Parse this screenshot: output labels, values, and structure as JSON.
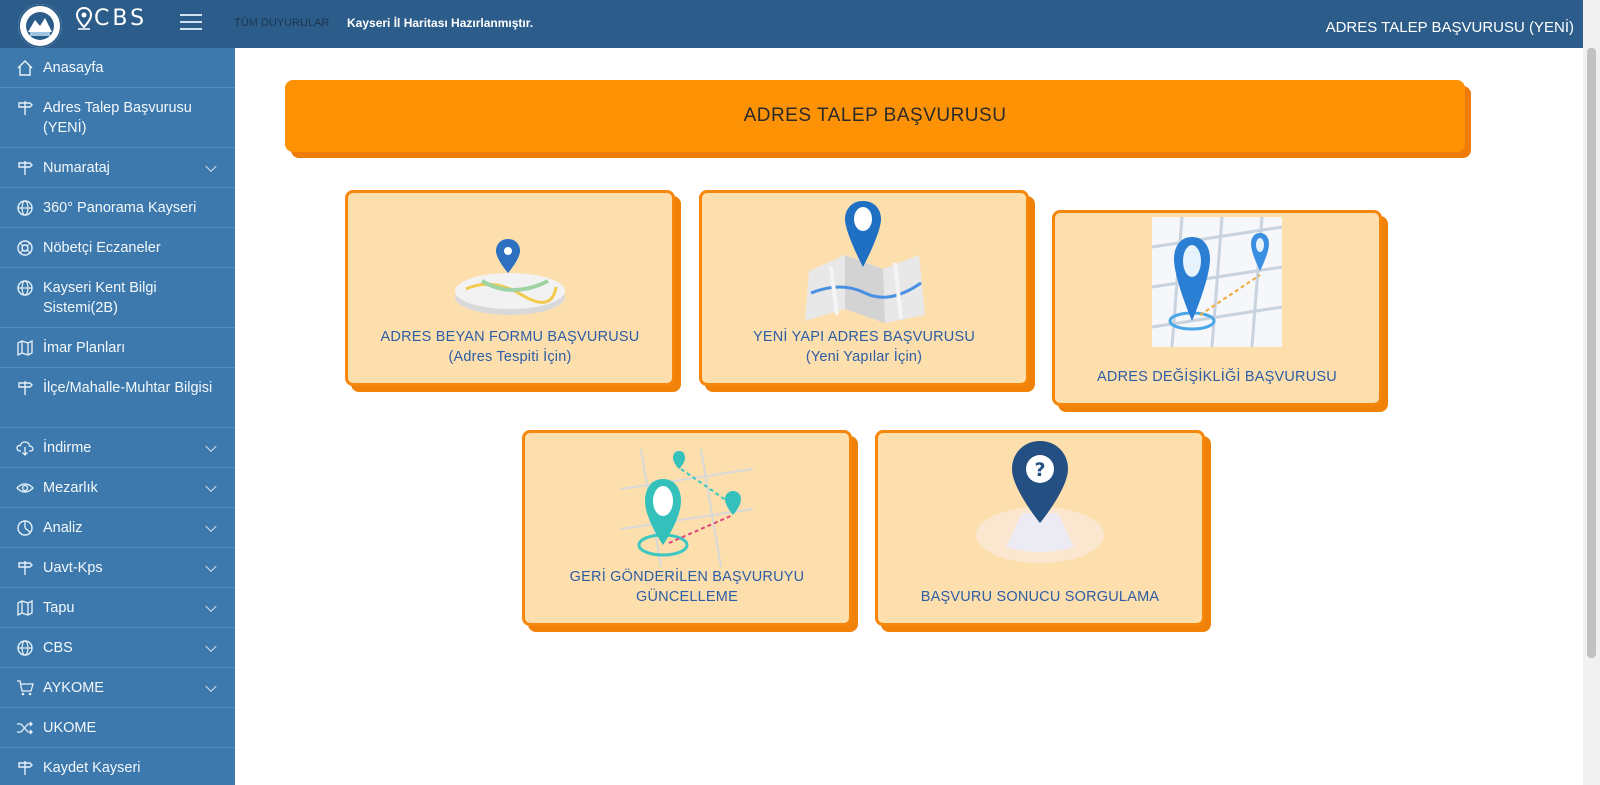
{
  "topbar": {
    "brand": "CBS",
    "all_news": "TÜM DUYURULAR",
    "ticker": "Kayseri İl Haritası Hazırlanmıştır.",
    "page_title": "ADRES TALEP BAŞVURUSU (YENİ)"
  },
  "sidebar": {
    "items": [
      {
        "label": "Anasayfa",
        "icon": "home-icon",
        "has_children": false
      },
      {
        "label": "Adres Talep Başvurusu (YENİ)",
        "icon": "signpost-icon",
        "has_children": false
      },
      {
        "label": "Numarataj",
        "icon": "signpost-icon",
        "has_children": true
      },
      {
        "label": "360° Panorama Kayseri",
        "icon": "globe-icon",
        "has_children": false
      },
      {
        "label": "Nöbetçi Eczaneler",
        "icon": "lifebuoy-icon",
        "has_children": false
      },
      {
        "label": "Kayseri Kent Bilgi Sistemi(2B)",
        "icon": "globe-icon",
        "has_children": false
      },
      {
        "label": "İmar Planları",
        "icon": "map-icon",
        "has_children": false
      },
      {
        "label": "İlçe/Mahalle-Muhtar Bilgisi",
        "icon": "signpost-icon",
        "has_children": false
      },
      {
        "label": "İndirme",
        "icon": "cloud-download-icon",
        "has_children": true
      },
      {
        "label": "Mezarlık",
        "icon": "eye-icon",
        "has_children": true
      },
      {
        "label": "Analiz",
        "icon": "pie-icon",
        "has_children": true
      },
      {
        "label": "Uavt-Kps",
        "icon": "signpost-icon",
        "has_children": true
      },
      {
        "label": "Tapu",
        "icon": "map-icon",
        "has_children": true
      },
      {
        "label": "CBS",
        "icon": "globe-icon",
        "has_children": true
      },
      {
        "label": "AYKOME",
        "icon": "cart-icon",
        "has_children": true
      },
      {
        "label": "UKOME",
        "icon": "shuffle-icon",
        "has_children": false
      },
      {
        "label": "Kaydet Kayseri",
        "icon": "signpost-icon",
        "has_children": false
      }
    ]
  },
  "main": {
    "banner": "ADRES TALEP BAŞVURUSU",
    "cards": [
      {
        "line1": "ADRES BEYAN FORMU BAŞVURUSU",
        "line2": "(Adres Tespiti İçin)",
        "icon": "map-pin-disc-icon"
      },
      {
        "line1": "YENİ YAPI ADRES BAŞVURUSU",
        "line2": "(Yeni Yapılar İçin)",
        "icon": "folded-map-pin-icon"
      },
      {
        "line1": "ADRES DEĞİŞİKLİĞİ BAŞVURUSU",
        "line2": "",
        "icon": "location-route-icon"
      },
      {
        "line1": "GERİ GÖNDERİLEN BAŞVURUYU GÜNCELLEME",
        "line2": "",
        "icon": "route-pins-icon"
      },
      {
        "line1": "BAŞVURU SONUCU SORGULAMA",
        "line2": "",
        "icon": "question-pin-icon"
      }
    ]
  },
  "colors": {
    "topbar": "#2c5d8a",
    "sidebar": "#3d79ad",
    "banner": "#fe9205",
    "card_bg": "#fddfae",
    "card_border": "#f6860c",
    "card_text": "#2d5da5"
  }
}
